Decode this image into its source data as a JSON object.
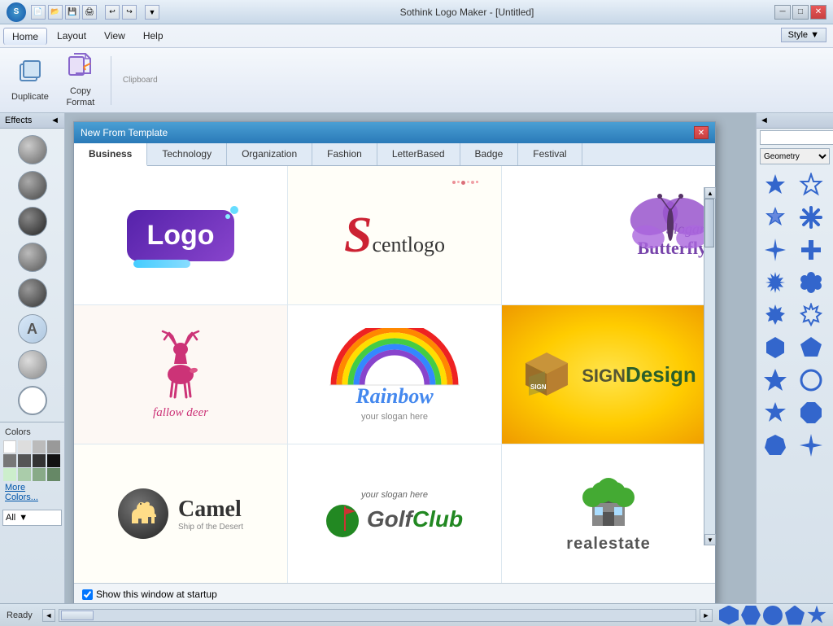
{
  "app": {
    "title": "Sothink Logo Maker - [Untitled]",
    "style_label": "Style ▼"
  },
  "titlebar": {
    "controls": [
      "─",
      "□",
      "✕"
    ]
  },
  "menu": {
    "items": [
      "Home",
      "Layout",
      "View",
      "Help"
    ]
  },
  "ribbon": {
    "duplicate_label": "Duplicate",
    "copy_format_label": "Copy\nFormat",
    "clipboard_label": "Clipboard"
  },
  "effects": {
    "header": "Effects",
    "collapse": "◄"
  },
  "colors": {
    "header": "Colors",
    "more_label": "More Colors...",
    "all_label": "All",
    "palette": [
      "#ffffff",
      "#dddddd",
      "#bbbbbb",
      "#999999",
      "#777777",
      "#555555",
      "#333333",
      "#111111",
      "#ffeeee",
      "#ffcccc",
      "#ff9999",
      "#ff6666"
    ]
  },
  "modal": {
    "title": "New From Template",
    "tabs": [
      "Business",
      "Technology",
      "Organization",
      "Fashion",
      "LetterBased",
      "Badge",
      "Festival"
    ],
    "active_tab": "Business",
    "close": "✕",
    "templates": [
      {
        "id": 1,
        "name": "Logo purple"
      },
      {
        "id": 2,
        "name": "Scentlogo"
      },
      {
        "id": 3,
        "name": "Slogan Butterfly"
      },
      {
        "id": 4,
        "name": "fallow deer"
      },
      {
        "id": 5,
        "name": "Rainbow"
      },
      {
        "id": 6,
        "name": "SignDesign"
      },
      {
        "id": 7,
        "name": "Camel"
      },
      {
        "id": 8,
        "name": "GolfClub"
      },
      {
        "id": 9,
        "name": "realestate"
      }
    ],
    "footer_checkbox": "Show this window at startup"
  },
  "right_panel": {
    "header": "Geometry",
    "search_placeholder": ""
  },
  "status": {
    "text": "Ready"
  },
  "scrollbar": {
    "left": "◄",
    "right": "►"
  }
}
